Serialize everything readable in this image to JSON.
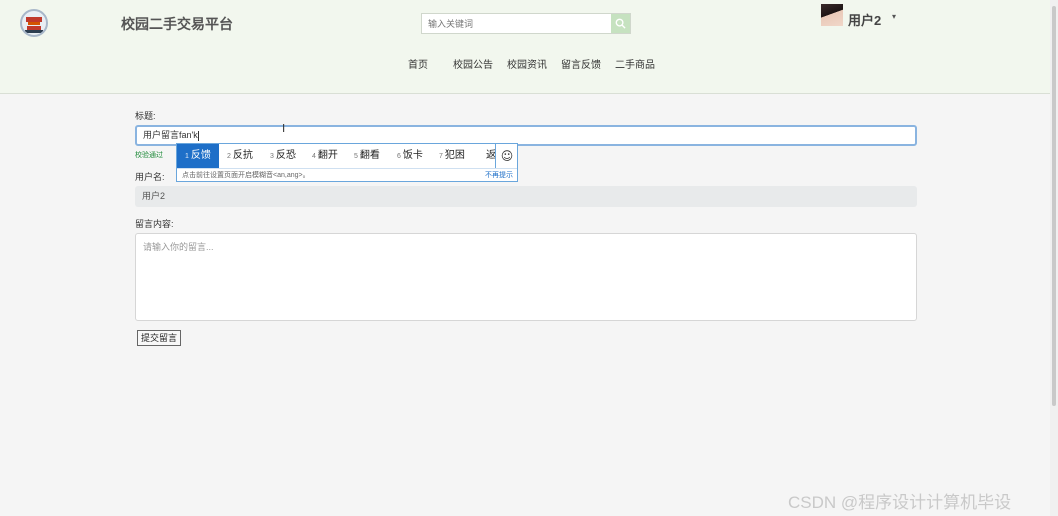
{
  "header": {
    "site_title": "校园二手交易平台",
    "search_placeholder": "输入关键词",
    "user_name": "用户2",
    "user_caret": "▾",
    "nav": [
      "首页",
      "校园公告",
      "校园资讯",
      "留言反馈",
      "二手商品"
    ]
  },
  "form": {
    "title_label": "标题:",
    "title_value": "用户留言fan'k",
    "validation_text": "校验通过",
    "username_label": "用户名:",
    "username_value": "用户2",
    "content_label": "留言内容:",
    "content_placeholder": "请输入你的留言...",
    "submit_label": "提交留言"
  },
  "ime": {
    "candidates": [
      {
        "index": "1",
        "text": "反馈"
      },
      {
        "index": "2",
        "text": "反抗"
      },
      {
        "index": "3",
        "text": "反恐"
      },
      {
        "index": "4",
        "text": "翻开"
      },
      {
        "index": "5",
        "text": "翻看"
      },
      {
        "index": "6",
        "text": "饭卡"
      },
      {
        "index": "7",
        "text": "犯困"
      },
      {
        "index": "",
        "text": "返"
      }
    ],
    "emoji_glyph": "☺",
    "hint": "点击前往设置页面开启模糊音<an,ang>。",
    "no_tip": "不再提示"
  },
  "watermark": "CSDN @程序设计计算机毕设",
  "colors": {
    "header_bg": "#f2f7ee",
    "search_button": "#c6e2c0",
    "ime_selected": "#1e6fc8",
    "valid_green": "#1f8a3a"
  }
}
